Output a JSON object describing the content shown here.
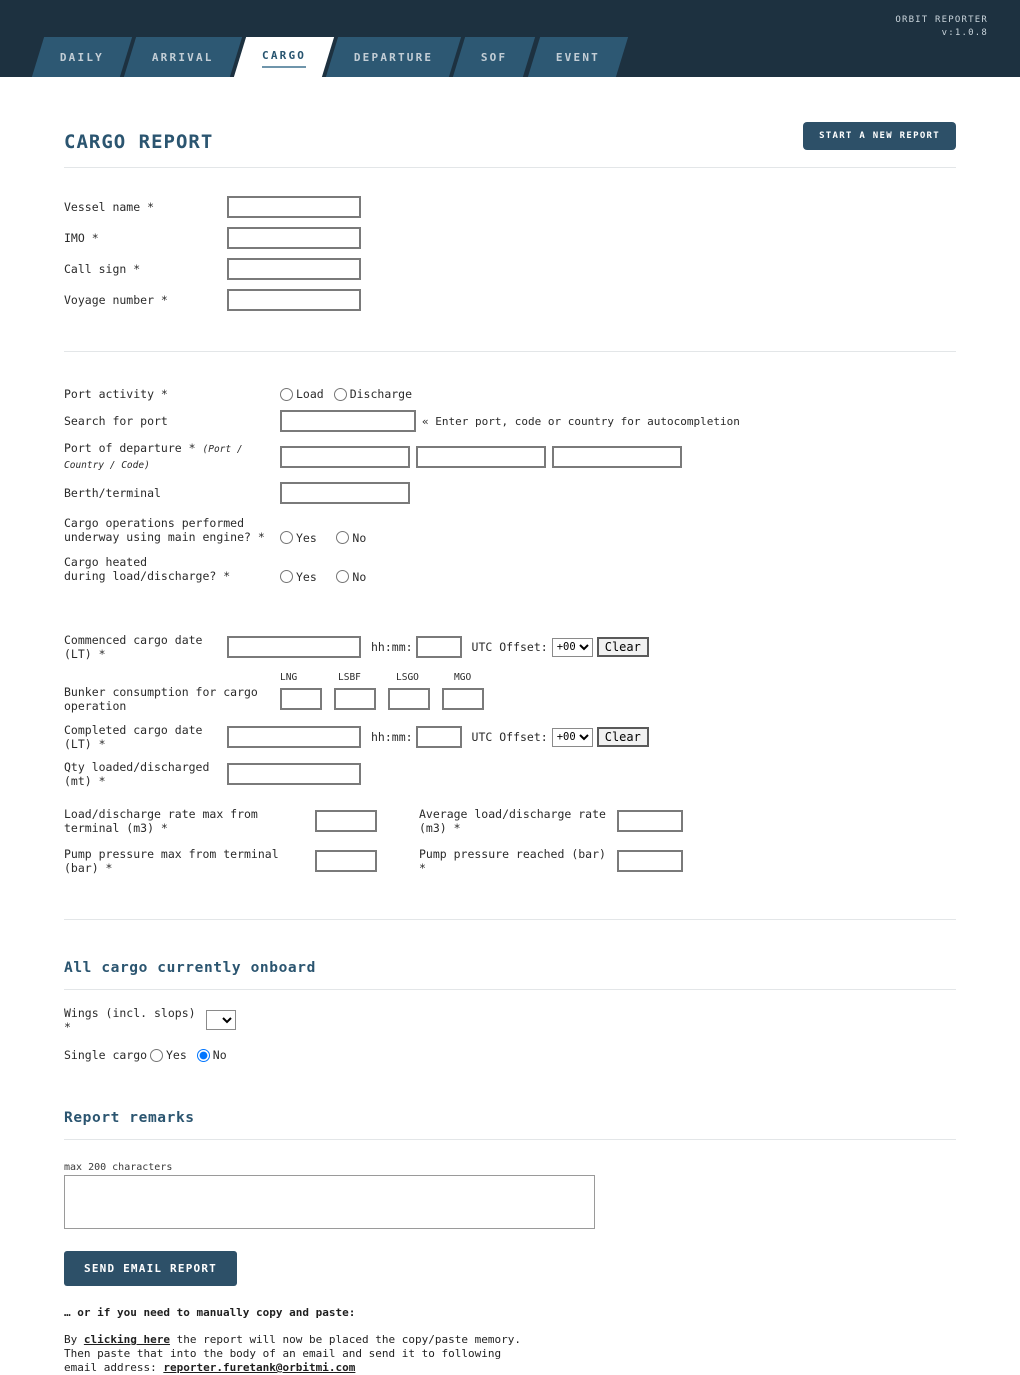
{
  "header": {
    "brand": "ORBIT REPORTER",
    "version": "v:1.0.8",
    "tabs": [
      {
        "label": "DAILY",
        "active": false
      },
      {
        "label": "ARRIVAL",
        "active": false
      },
      {
        "label": "CARGO",
        "active": true
      },
      {
        "label": "DEPARTURE",
        "active": false
      },
      {
        "label": "SOF",
        "active": false
      },
      {
        "label": "EVENT",
        "active": false
      }
    ]
  },
  "page": {
    "title": "CARGO REPORT",
    "new_report_button": "START A NEW REPORT"
  },
  "vessel": {
    "fields": [
      {
        "label": "Vessel name *",
        "value": ""
      },
      {
        "label": "IMO *",
        "value": ""
      },
      {
        "label": "Call sign *",
        "value": ""
      },
      {
        "label": "Voyage number *",
        "value": ""
      }
    ]
  },
  "port": {
    "activity_label": "Port activity *",
    "activity_options": [
      "Load",
      "Discharge"
    ],
    "search_label": "Search for port",
    "search_value": "",
    "search_hint": "« Enter port, code or country for autocompletion",
    "departure_label": "Port of departure *",
    "departure_sublabel": "(Port / Country / Code)",
    "departure_values": [
      "",
      "",
      ""
    ],
    "berth_label": "Berth/terminal",
    "berth_value": "",
    "underway_label_line1": "Cargo operations performed",
    "underway_label_line2": "underway using main engine? *",
    "underway_options": [
      "Yes",
      "No"
    ],
    "heated_label_line1": "Cargo heated",
    "heated_label_line2": "during load/discharge? *",
    "heated_options": [
      "Yes",
      "No"
    ]
  },
  "dates": {
    "commenced_label": "Commenced cargo date (LT) *",
    "commenced_value": "",
    "commenced_time_label": "hh:mm:",
    "commenced_time_value": "",
    "commenced_utc_label": "UTC Offset:",
    "commenced_utc_value": "+00",
    "commenced_clear": "Clear",
    "bunker_label": "Bunker consumption for cargo operation",
    "bunker_heads": [
      "LNG",
      "LSBF",
      "LSGO",
      "MGO"
    ],
    "bunker_values": [
      "",
      "",
      "",
      ""
    ],
    "completed_label": "Completed cargo date (LT) *",
    "completed_value": "",
    "completed_time_label": "hh:mm:",
    "completed_time_value": "",
    "completed_utc_label": "UTC Offset:",
    "completed_utc_value": "+00",
    "completed_clear": "Clear",
    "qty_label": "Qty loaded/discharged (mt) *",
    "qty_value": "",
    "rate_max_label": "Load/discharge rate max from terminal (m3) *",
    "rate_max_value": "",
    "rate_avg_label": "Average load/discharge rate (m3) *",
    "rate_avg_value": "",
    "pump_max_label": "Pump pressure max from terminal (bar) *",
    "pump_max_value": "",
    "pump_reached_label": "Pump pressure reached (bar) *",
    "pump_reached_value": ""
  },
  "onboard": {
    "title": "All cargo currently onboard",
    "wings_label": "Wings (incl. slops) *",
    "wings_value": "",
    "single_cargo_label": "Single cargo",
    "single_cargo_options": [
      "Yes",
      "No"
    ],
    "single_cargo_selected": "No"
  },
  "remarks": {
    "title": "Report remarks",
    "max_chars": "max 200 characters",
    "value": "",
    "send_button": "SEND EMAIL REPORT",
    "manual_heading": "… or if you need to manually copy and paste:",
    "para_prefix": "By ",
    "para_link": "clicking here",
    "para_mid": " the report will now be placed the copy/paste memory.",
    "para_line2": "Then paste that into the body of an email and send it to following",
    "para_line3_prefix": "email address: ",
    "email": "reporter.furetank@orbitmi.com"
  },
  "colors": {
    "header_bg": "#1d3140",
    "tab_bg": "#2d5873",
    "accent": "#2b5570",
    "button": "#2d5068"
  }
}
